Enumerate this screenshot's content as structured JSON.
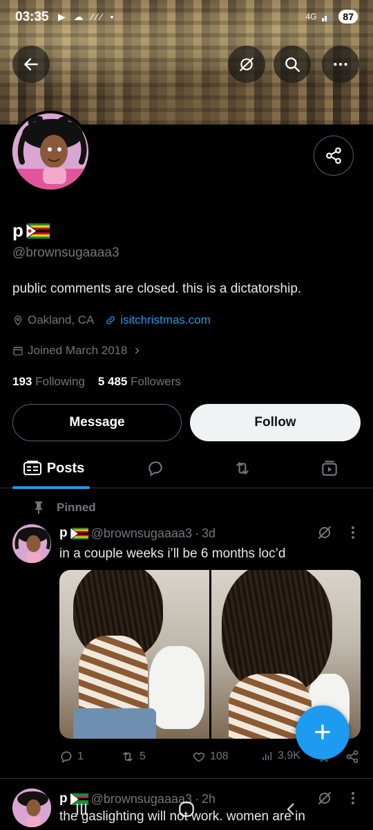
{
  "status": {
    "time": "03:35",
    "left_icons": "▶ ☁ ⁄⁄⁄ •",
    "network": "4G",
    "battery": "87"
  },
  "profile": {
    "name": "p",
    "handle": "@brownsugaaaa3",
    "bio": "public comments are closed. this is a dictatorship.",
    "location": "Oakland, CA",
    "website": "isitchristmas.com",
    "joined": "Joined March 2018",
    "following_count": "193",
    "following_label": "Following",
    "followers_count": "5 485",
    "followers_label": "Followers"
  },
  "buttons": {
    "message": "Message",
    "follow": "Follow"
  },
  "tabs": {
    "posts": "Posts"
  },
  "pinned_label": "Pinned",
  "tweets": [
    {
      "name": "p",
      "handle": "@brownsugaaaa3",
      "dot": "·",
      "time": "3d",
      "text": "in a couple weeks i’ll be 6 months loc’d",
      "replies": "1",
      "reposts": "5",
      "likes": "108",
      "views": "3,9K"
    },
    {
      "name": "p",
      "handle": "@brownsugaaaa3",
      "dot": "·",
      "time": "2h",
      "text": "the gaslighting will not work. women are in"
    }
  ],
  "colors": {
    "accent": "#1d9bf0",
    "background": "#000000",
    "secondary_text": "#71767b"
  }
}
